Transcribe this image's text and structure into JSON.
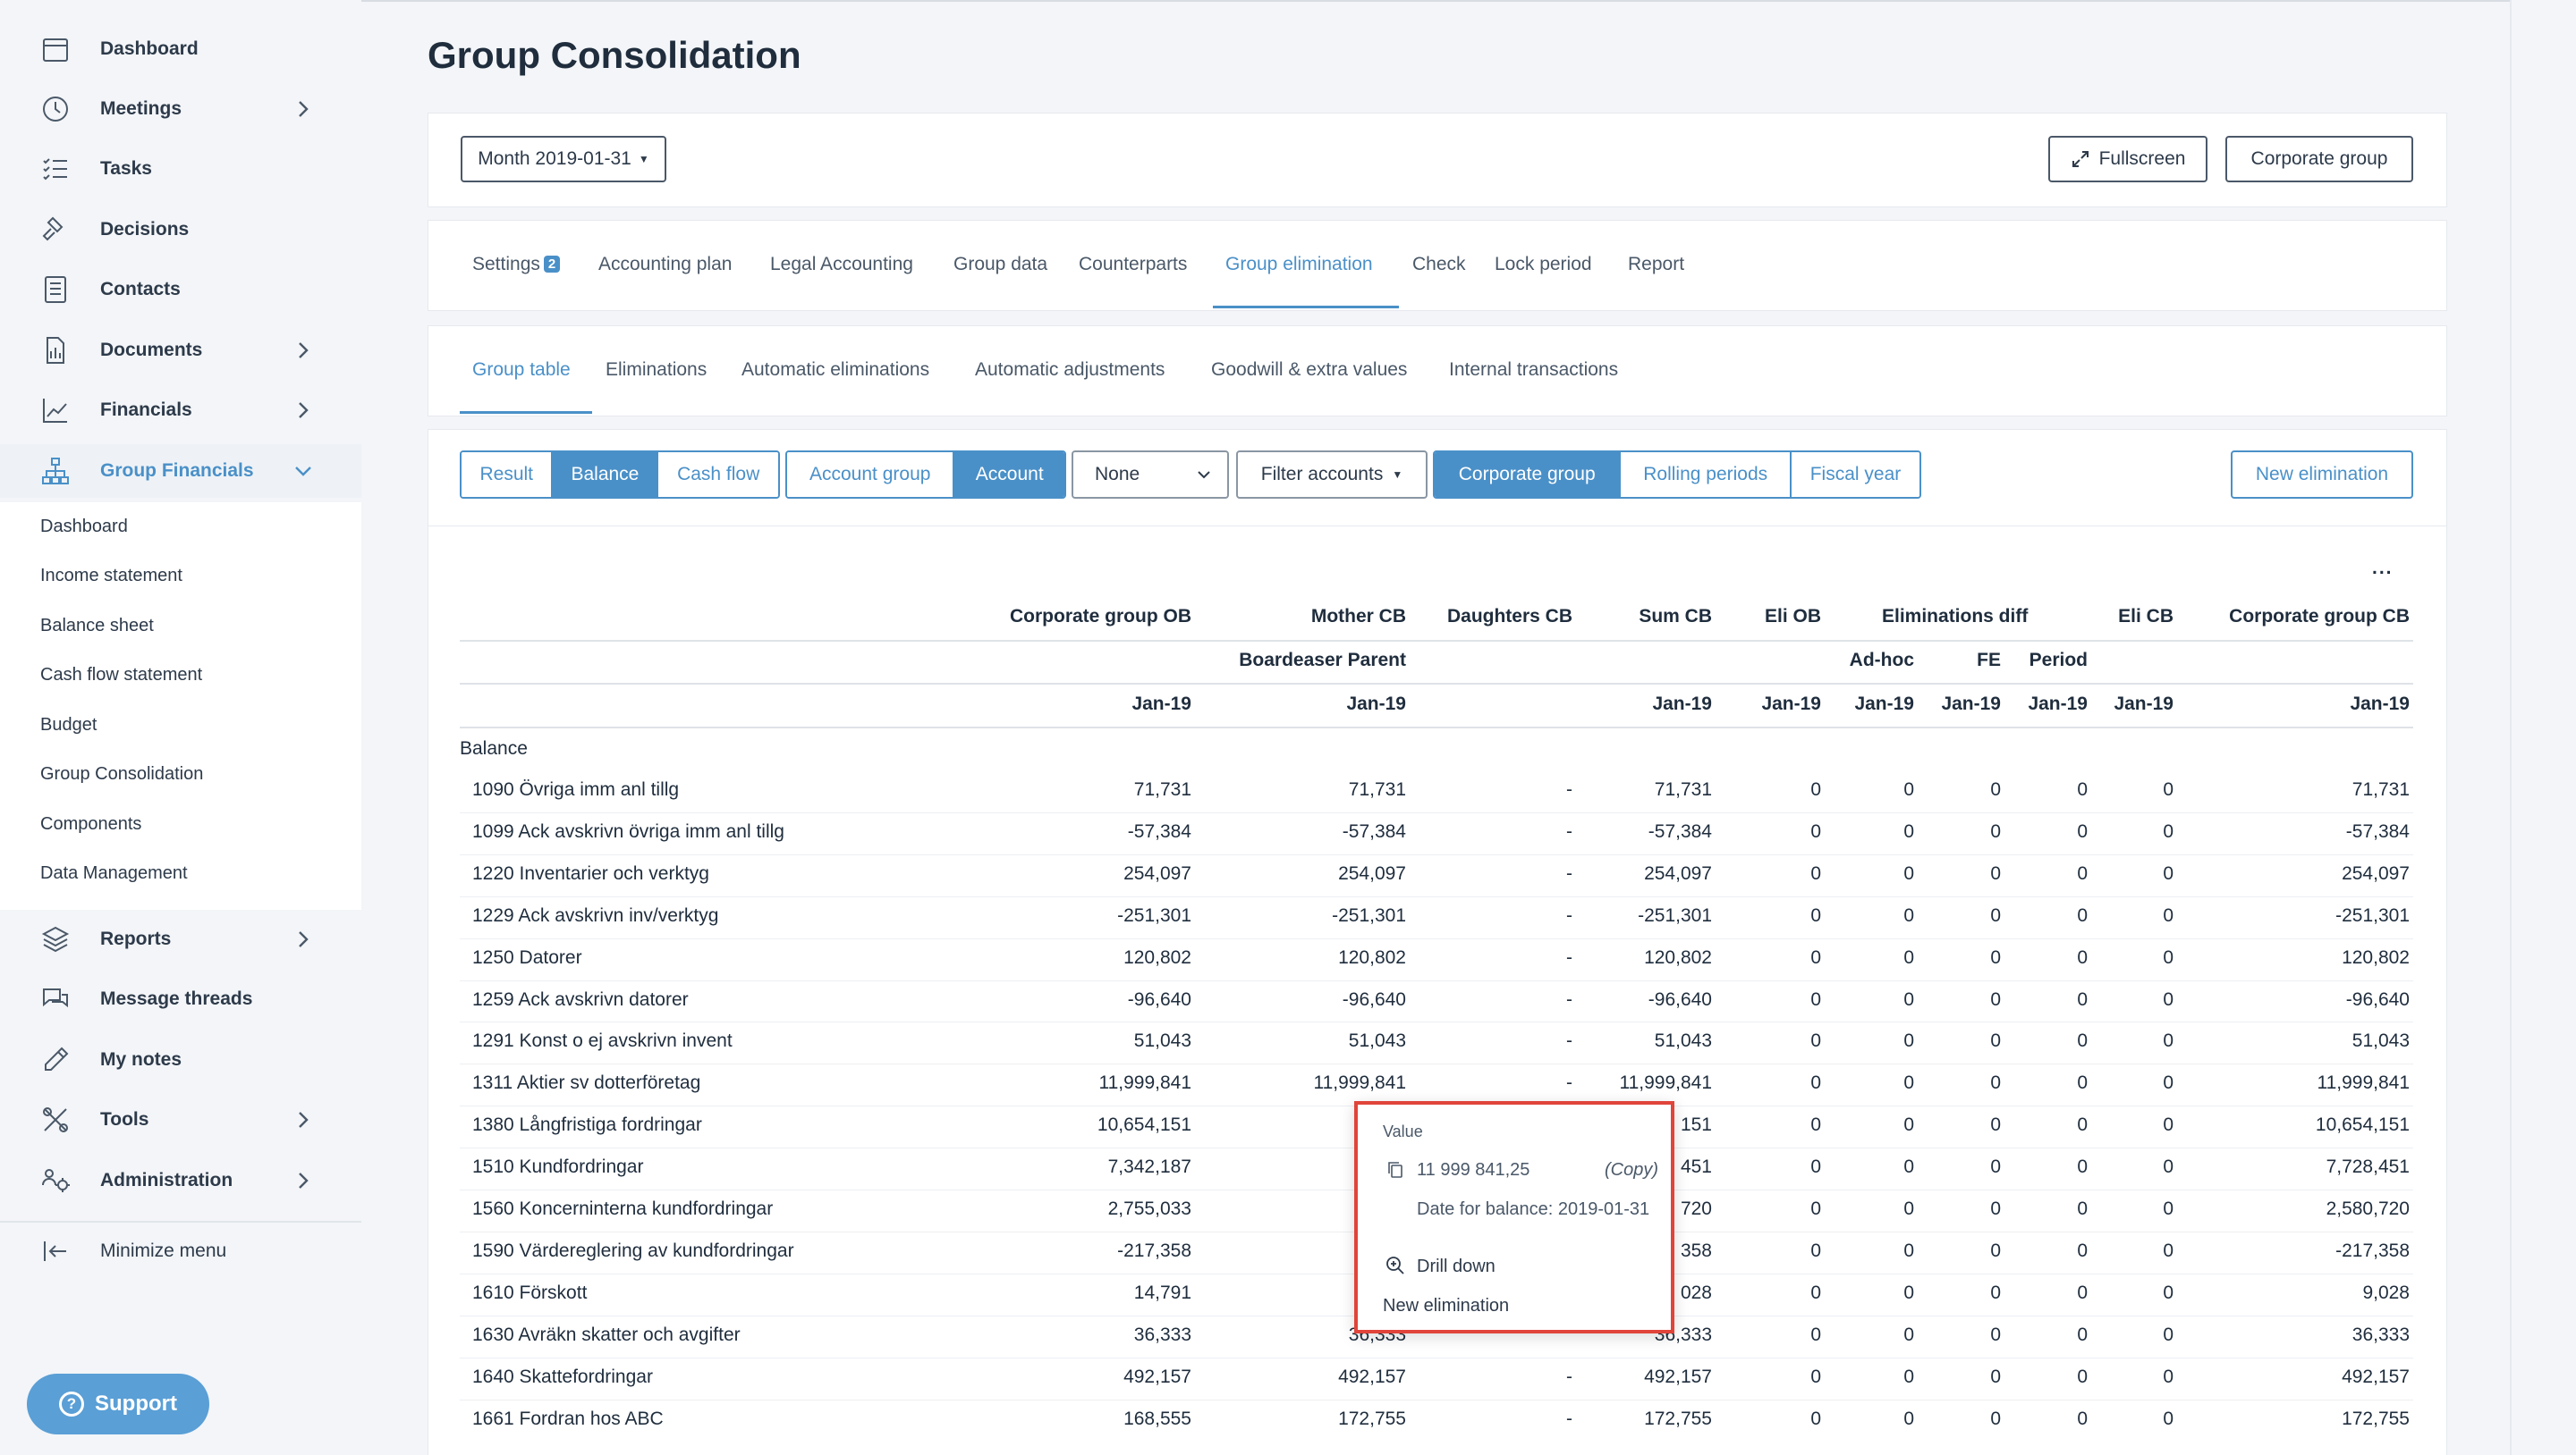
{
  "sidebar": {
    "items": [
      {
        "label": "Dashboard",
        "icon": "calendar-icon",
        "chevron": false
      },
      {
        "label": "Meetings",
        "icon": "clock-icon",
        "chevron": true
      },
      {
        "label": "Tasks",
        "icon": "checklist-icon",
        "chevron": false
      },
      {
        "label": "Decisions",
        "icon": "gavel-icon",
        "chevron": false
      },
      {
        "label": "Contacts",
        "icon": "address-book-icon",
        "chevron": false
      },
      {
        "label": "Documents",
        "icon": "document-icon",
        "chevron": true
      },
      {
        "label": "Financials",
        "icon": "line-chart-icon",
        "chevron": true
      },
      {
        "label": "Group Financials",
        "icon": "hierarchy-icon",
        "chevron": true,
        "expanded": true
      }
    ],
    "sub_items": [
      "Dashboard",
      "Income statement",
      "Balance sheet",
      "Cash flow statement",
      "Budget",
      "Group Consolidation",
      "Components",
      "Data Management"
    ],
    "bottom_items": [
      {
        "label": "Reports",
        "icon": "layers-icon",
        "chevron": true
      },
      {
        "label": "Message threads",
        "icon": "chat-bubbles-icon",
        "chevron": false
      },
      {
        "label": "My notes",
        "icon": "pencil-icon",
        "chevron": false
      },
      {
        "label": "Tools",
        "icon": "tools-icon",
        "chevron": true
      },
      {
        "label": "Administration",
        "icon": "users-gear-icon",
        "chevron": true
      }
    ],
    "minimize": "Minimize menu",
    "support": "Support"
  },
  "page": {
    "title": "Group Consolidation",
    "period_select": "Month 2019-01-31",
    "fullscreen": "Fullscreen",
    "corporate_group": "Corporate group"
  },
  "tabs": [
    "Settings",
    "Accounting plan",
    "Legal Accounting",
    "Group data",
    "Counterparts",
    "Group elimination",
    "Check",
    "Lock period",
    "Report"
  ],
  "settings_badge": "2",
  "subtabs": [
    "Group table",
    "Eliminations",
    "Automatic eliminations",
    "Automatic adjustments",
    "Goodwill & extra values",
    "Internal transactions"
  ],
  "toolbar": {
    "view_seg": [
      "Result",
      "Balance",
      "Cash flow"
    ],
    "level_seg": [
      "Account group",
      "Account"
    ],
    "none_select": "None",
    "filter": "Filter accounts",
    "period_seg": [
      "Corporate group",
      "Rolling periods",
      "Fiscal year"
    ],
    "new_elimination": "New elimination",
    "more": "..."
  },
  "table": {
    "headers": [
      "Corporate group OB",
      "Mother CB",
      "Daughters CB",
      "Sum CB",
      "Eli OB",
      "Eliminations diff",
      "Eli CB",
      "Corporate group CB"
    ],
    "subheaders": {
      "mother": "Boardeaser Parent",
      "adhoc": "Ad-hoc",
      "fe": "FE",
      "period": "Period"
    },
    "period_label": "Jan-19",
    "section": "Balance",
    "rows": [
      [
        "1090 Övriga imm anl tillg",
        "71,731",
        "71,731",
        "-",
        "71,731",
        "0",
        "0",
        "0",
        "0",
        "0",
        "71,731"
      ],
      [
        "1099 Ack avskrivn övriga imm anl tillg",
        "-57,384",
        "-57,384",
        "-",
        "-57,384",
        "0",
        "0",
        "0",
        "0",
        "0",
        "-57,384"
      ],
      [
        "1220 Inventarier och verktyg",
        "254,097",
        "254,097",
        "-",
        "254,097",
        "0",
        "0",
        "0",
        "0",
        "0",
        "254,097"
      ],
      [
        "1229 Ack avskrivn inv/verktyg",
        "-251,301",
        "-251,301",
        "-",
        "-251,301",
        "0",
        "0",
        "0",
        "0",
        "0",
        "-251,301"
      ],
      [
        "1250 Datorer",
        "120,802",
        "120,802",
        "-",
        "120,802",
        "0",
        "0",
        "0",
        "0",
        "0",
        "120,802"
      ],
      [
        "1259 Ack avskrivn datorer",
        "-96,640",
        "-96,640",
        "-",
        "-96,640",
        "0",
        "0",
        "0",
        "0",
        "0",
        "-96,640"
      ],
      [
        "1291 Konst o ej avskrivn invent",
        "51,043",
        "51,043",
        "-",
        "51,043",
        "0",
        "0",
        "0",
        "0",
        "0",
        "51,043"
      ],
      [
        "1311 Aktier sv dotterföretag",
        "11,999,841",
        "11,999,841",
        "-",
        "11,999,841",
        "0",
        "0",
        "0",
        "0",
        "0",
        "11,999,841"
      ],
      [
        "1380 Långfristiga fordringar",
        "10,654,151",
        "10,65",
        "",
        "151",
        "0",
        "0",
        "0",
        "0",
        "0",
        "10,654,151"
      ],
      [
        "1510 Kundfordringar",
        "7,342,187",
        "7,72",
        "",
        "451",
        "0",
        "0",
        "0",
        "0",
        "0",
        "7,728,451"
      ],
      [
        "1560 Koncerninterna kundfordringar",
        "2,755,033",
        "2,58",
        "",
        "720",
        "0",
        "0",
        "0",
        "0",
        "0",
        "2,580,720"
      ],
      [
        "1590 Värdereglering av kundfordringar",
        "-217,358",
        "-21",
        "",
        "358",
        "0",
        "0",
        "0",
        "0",
        "0",
        "-217,358"
      ],
      [
        "1610 Förskott",
        "14,791",
        "",
        "",
        "028",
        "0",
        "0",
        "0",
        "0",
        "0",
        "9,028"
      ],
      [
        "1630 Avräkn skatter och avgifter",
        "36,333",
        "36,333",
        "",
        "36,333",
        "0",
        "0",
        "0",
        "0",
        "0",
        "36,333"
      ],
      [
        "1640 Skattefordringar",
        "492,157",
        "492,157",
        "-",
        "492,157",
        "0",
        "0",
        "0",
        "0",
        "0",
        "492,157"
      ],
      [
        "1661 Fordran hos ABC",
        "168,555",
        "172,755",
        "-",
        "172,755",
        "0",
        "0",
        "0",
        "0",
        "0",
        "172,755"
      ]
    ]
  },
  "popover": {
    "title": "Value",
    "value": "11 999 841,25",
    "copy": "(Copy)",
    "date": "Date for balance: 2019-01-31",
    "drill": "Drill down",
    "new_elim": "New elimination"
  }
}
